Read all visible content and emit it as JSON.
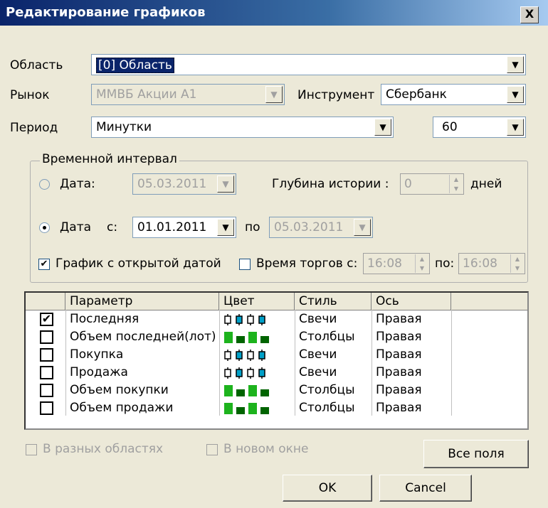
{
  "window": {
    "title": "Редактирование графиков",
    "close_label": "X"
  },
  "area": {
    "label": "Область",
    "value": "[0] Область"
  },
  "market": {
    "label": "Рынок",
    "value": "ММВБ Акции А1"
  },
  "instrument": {
    "label": "Инструмент",
    "value": "Сбербанк"
  },
  "period": {
    "label": "Период",
    "value": "Минутки",
    "interval_value": "60"
  },
  "time_interval": {
    "legend": "Временной интервал",
    "date_label": "Дата:",
    "date_value": "05.03.2011",
    "history_label": "Глубина истории :",
    "history_value": "0",
    "history_unit": "дней",
    "date_range_label": "Дата",
    "from_label": "с:",
    "from_value": "01.01.2011",
    "to_label": "по",
    "to_value": "05.03.2011",
    "open_date_label": "График с открытой датой",
    "open_date_checked": true,
    "trade_time_label": "Время торгов с:",
    "trade_from": "16:08",
    "trade_to_label": "по:",
    "trade_to": "16:08",
    "selected_mode": "range"
  },
  "table": {
    "headers": [
      "Параметр",
      "Цвет",
      "Стиль",
      "Ось"
    ],
    "rows": [
      {
        "checked": true,
        "param": "Последняя",
        "color": "candles",
        "style": "Свечи",
        "axis": "Правая"
      },
      {
        "checked": false,
        "param": "Объем последней(лот)",
        "color": "bars",
        "style": "Столбцы",
        "axis": "Правая"
      },
      {
        "checked": false,
        "param": "Покупка",
        "color": "candles",
        "style": "Свечи",
        "axis": "Правая"
      },
      {
        "checked": false,
        "param": "Продажа",
        "color": "candles",
        "style": "Свечи",
        "axis": "Правая"
      },
      {
        "checked": false,
        "param": "Объем покупки",
        "color": "bars",
        "style": "Столбцы",
        "axis": "Правая"
      },
      {
        "checked": false,
        "param": "Объем продажи",
        "color": "bars",
        "style": "Столбцы",
        "axis": "Правая"
      }
    ]
  },
  "options": {
    "separate_areas": "В разных областях",
    "new_window": "В новом окне"
  },
  "buttons": {
    "all_fields": "Все поля",
    "ok": "OK",
    "cancel": "Cancel"
  },
  "colors": {
    "candle_body": "#00a0c8",
    "bar_green": "#1db31d",
    "bar_dark": "#006400"
  },
  "checkmark": "✔"
}
